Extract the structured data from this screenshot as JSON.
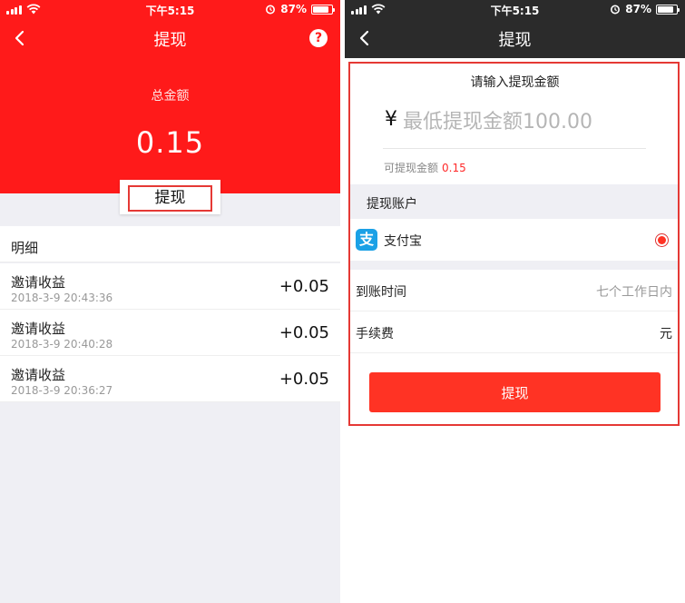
{
  "colors": {
    "brand_red": "#ff1a1a",
    "nav_dark": "#2b2b2b",
    "button_red": "#ff3324",
    "amount_red": "#ff2a2a",
    "alipay_blue": "#1ba1e6"
  },
  "status_bar": {
    "time": "下午5:15",
    "battery": "87%",
    "icons": [
      "signal-icon",
      "wifi-icon",
      "alarm-icon",
      "battery-icon"
    ]
  },
  "left": {
    "nav": {
      "title": "提现",
      "back_icon": "chevron-left-icon",
      "help_icon": "question-icon",
      "help_glyph": "?"
    },
    "total_label": "总金额",
    "total_amount": "0.15",
    "withdraw_button": "提现",
    "detail_header": "明细",
    "records": [
      {
        "title": "邀请收益",
        "time": "2018-3-9 20:43:36",
        "amount": "+0.05"
      },
      {
        "title": "邀请收益",
        "time": "2018-3-9 20:40:28",
        "amount": "+0.05"
      },
      {
        "title": "邀请收益",
        "time": "2018-3-9 20:36:27",
        "amount": "+0.05"
      }
    ]
  },
  "right": {
    "nav": {
      "title": "提现",
      "back_icon": "chevron-left-icon"
    },
    "amount_section": {
      "label": "请输入提现金额",
      "currency_symbol": "¥",
      "placeholder": "最低提现金额100.00",
      "value": "",
      "available_label": "可提现金额",
      "available_value": "0.15"
    },
    "account_header": "提现账户",
    "account": {
      "name": "支付宝",
      "icon": "alipay-icon",
      "icon_glyph": "支",
      "selected": true
    },
    "arrival": {
      "label": "到账时间",
      "value": "七个工作日内"
    },
    "fee": {
      "label": "手续费",
      "value": "元"
    },
    "submit_button": "提现"
  }
}
